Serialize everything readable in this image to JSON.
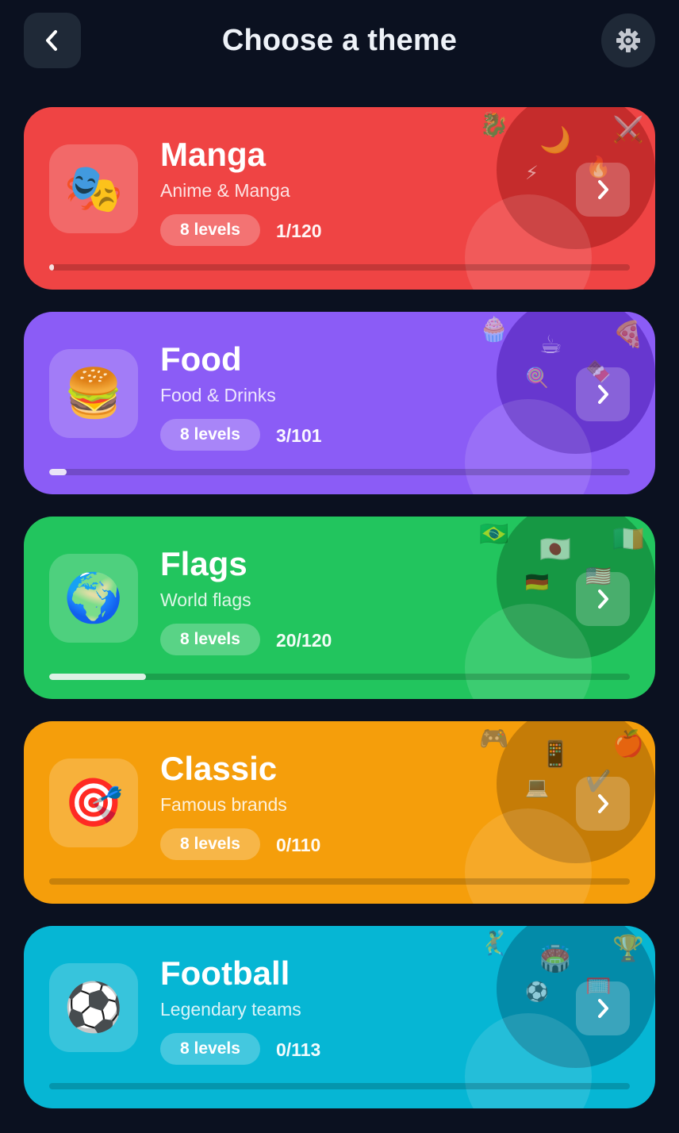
{
  "header": {
    "title": "Choose a theme",
    "back_icon": "chevron-left-icon",
    "settings_icon": "gear-icon"
  },
  "themes": [
    {
      "title": "Manga",
      "subtitle": "Anime & Manga",
      "levels": "8 levels",
      "progress": "1/120",
      "progress_fraction": 0.0083,
      "icon": "🎭",
      "color": "#ef4444",
      "blob_color": "rgba(120,0,0,0.35)",
      "decorations": [
        "🐉",
        "🌙",
        "⚔️",
        "⚡",
        "🔥"
      ]
    },
    {
      "title": "Food",
      "subtitle": "Food & Drinks",
      "levels": "8 levels",
      "progress": "3/101",
      "progress_fraction": 0.0297,
      "icon": "🍔",
      "color": "#8b5cf6",
      "blob_color": "rgba(60,10,160,0.45)",
      "decorations": [
        "🧁",
        "☕",
        "🍕",
        "🍭",
        "🍫"
      ]
    },
    {
      "title": "Flags",
      "subtitle": "World flags",
      "levels": "8 levels",
      "progress": "20/120",
      "progress_fraction": 0.1667,
      "icon": "🌍",
      "color": "#22c55e",
      "blob_color": "rgba(0,70,20,0.35)",
      "decorations": [
        "🇧🇷",
        "🇯🇵",
        "🇮🇪",
        "🇩🇪",
        "🇺🇸"
      ]
    },
    {
      "title": "Classic",
      "subtitle": "Famous brands",
      "levels": "8 levels",
      "progress": "0/110",
      "progress_fraction": 0,
      "icon": "🎯",
      "color": "#f59e0b",
      "blob_color": "rgba(110,60,0,0.35)",
      "decorations": [
        "🎮",
        "📱",
        "🍎",
        "💻",
        "✔️"
      ]
    },
    {
      "title": "Football",
      "subtitle": "Legendary teams",
      "levels": "8 levels",
      "progress": "0/113",
      "progress_fraction": 0,
      "icon": "⚽",
      "color": "#06b6d4",
      "blob_color": "rgba(0,60,90,0.35)",
      "decorations": [
        "🤾",
        "🏟️",
        "🏆",
        "⚽",
        "🥅"
      ]
    }
  ]
}
